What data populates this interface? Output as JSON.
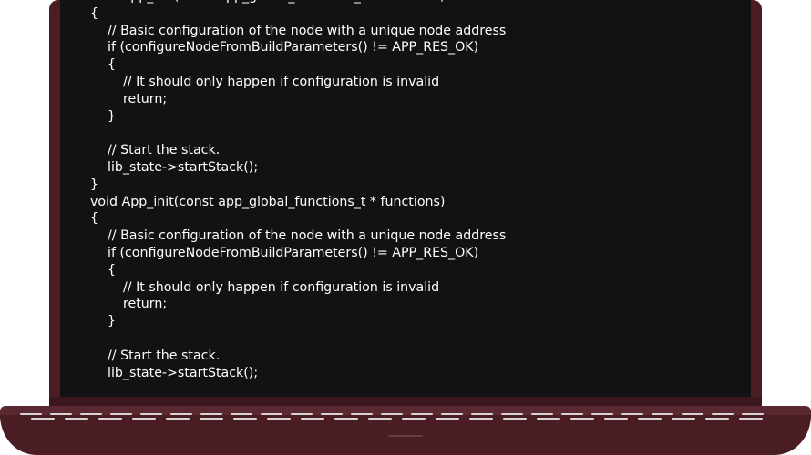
{
  "code_lines": [
    {
      "indent": 0,
      "text": "void App_init(const app_global_functions_t * functions)"
    },
    {
      "indent": 0,
      "text": "{"
    },
    {
      "indent": 1,
      "text": "// Basic configuration of the node with a unique node address"
    },
    {
      "indent": 1,
      "text": "if (configureNodeFromBuildParameters() != APP_RES_OK)"
    },
    {
      "indent": 1,
      "text": "{"
    },
    {
      "indent": 2,
      "text": "// It should only happen if configuration is invalid"
    },
    {
      "indent": 2,
      "text": "return;"
    },
    {
      "indent": 1,
      "text": "}"
    },
    {
      "indent": 1,
      "text": ""
    },
    {
      "indent": 1,
      "text": "// Start the stack."
    },
    {
      "indent": 1,
      "text": "lib_state->startStack();"
    },
    {
      "indent": 0,
      "text": "}"
    },
    {
      "indent": 0,
      "text": "void App_init(const app_global_functions_t * functions)"
    },
    {
      "indent": 0,
      "text": "{"
    },
    {
      "indent": 1,
      "text": "// Basic configuration of the node with a unique node address"
    },
    {
      "indent": 1,
      "text": "if (configureNodeFromBuildParameters() != APP_RES_OK)"
    },
    {
      "indent": 1,
      "text": "{"
    },
    {
      "indent": 2,
      "text": "// It should only happen if configuration is invalid"
    },
    {
      "indent": 2,
      "text": "return;"
    },
    {
      "indent": 1,
      "text": "}"
    },
    {
      "indent": 1,
      "text": ""
    },
    {
      "indent": 1,
      "text": "// Start the stack."
    },
    {
      "indent": 1,
      "text": "lib_state->startStack();"
    }
  ],
  "colors": {
    "laptop_body": "#4a1d24",
    "screen_background": "#111214",
    "code_text": "#ffffff",
    "keys": "#d9d4d4"
  }
}
